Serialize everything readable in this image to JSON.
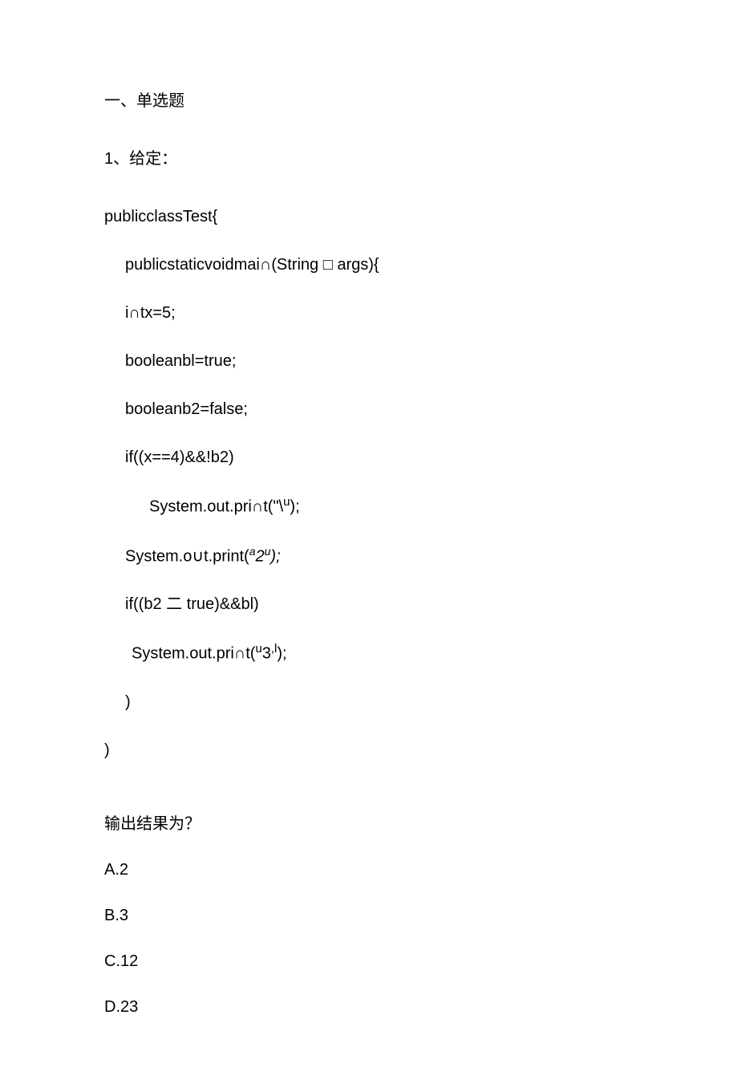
{
  "section": {
    "title": "一、单选题"
  },
  "question": {
    "prompt": "1、给定：",
    "result_label": "输出结果为？"
  },
  "code": {
    "line1": "publicclassTest{",
    "line2": "publicstaticvoidmai∩(String □ args){",
    "line3": "i∩tx=5;",
    "line4": "booleanbl=true;",
    "line5": "booleanb2=false;",
    "line6": "if((x==4)&&!b2)",
    "line7_a": "System.out.pri∩t(",
    "line7_b": "\"\\",
    "line7_c": "u",
    "line7_d": ");",
    "line8_a": "System.o∪t.print(",
    "line8_b": "a",
    "line8_c": "2",
    "line8_d": "u",
    "line8_e": ");",
    "line9": "if((b2 ⼆ true)&&bl)",
    "line10_a": "System.out.pri∩t(",
    "line10_b": "u",
    "line10_c": "3",
    "line10_d": ",l",
    "line10_e": ");",
    "line11": ")",
    "line12": ")"
  },
  "options": {
    "a": "A.2",
    "b": "B.3",
    "c": "C.12",
    "d": "D.23"
  }
}
